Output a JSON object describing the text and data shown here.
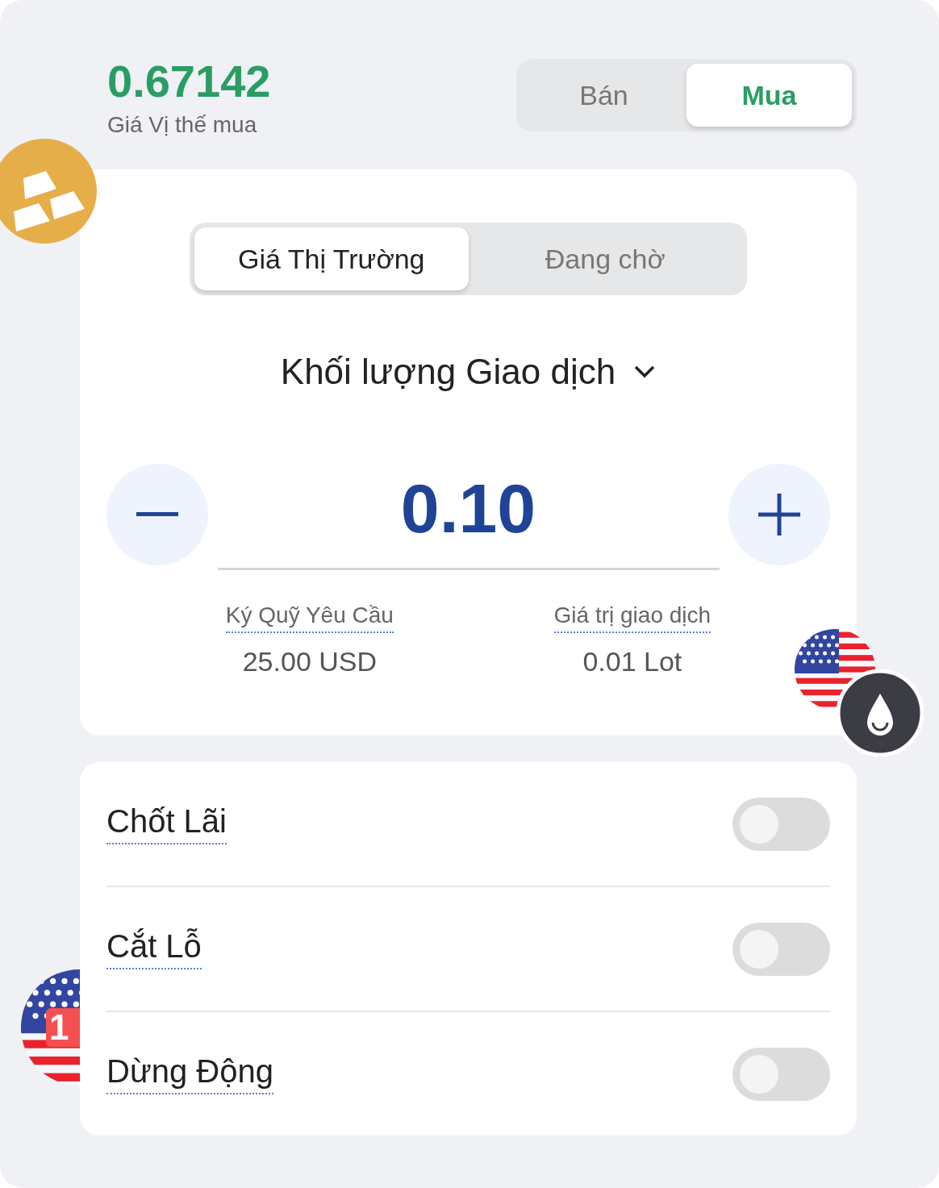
{
  "price": {
    "value": "0.67142",
    "label": "Giá Vị thế mua"
  },
  "side_tabs": [
    {
      "label": "Bán",
      "selected": false
    },
    {
      "label": "Mua",
      "selected": true
    }
  ],
  "order_tabs": [
    {
      "label": "Giá Thị Trường",
      "selected": true
    },
    {
      "label": "Đang chờ",
      "selected": false
    }
  ],
  "volume": {
    "label": "Khối lượng Giao dịch",
    "value": "0.10"
  },
  "stats": [
    {
      "label": "Ký Quỹ Yêu Cầu",
      "value": "25.00 USD"
    },
    {
      "label": "Giá trị giao dịch",
      "value": "0.01 Lot"
    }
  ],
  "toggles": [
    {
      "label": "Chốt Lãi",
      "on": false
    },
    {
      "label": "Cắt Lỗ",
      "on": false
    },
    {
      "label": "Dừng Động",
      "on": false
    }
  ],
  "flag_badge": {
    "text": "1"
  }
}
